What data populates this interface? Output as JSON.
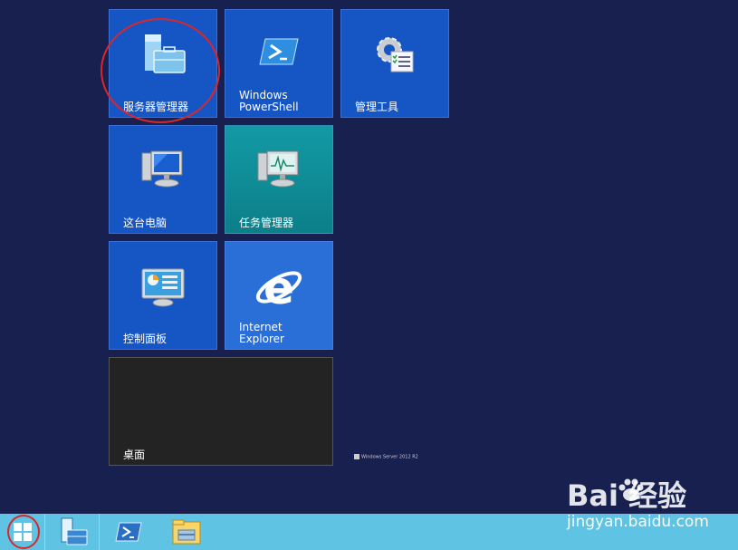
{
  "tiles": {
    "server_manager": {
      "label": "服务器管理器",
      "icon": "server-manager-icon"
    },
    "powershell": {
      "label": "Windows\nPowerShell",
      "icon": "powershell-icon"
    },
    "admin_tools": {
      "label": "管理工具",
      "icon": "admin-tools-icon"
    },
    "this_pc": {
      "label": "这台电脑",
      "icon": "computer-icon"
    },
    "task_manager": {
      "label": "任务管理器",
      "icon": "task-manager-icon"
    },
    "control_panel": {
      "label": "控制面板",
      "icon": "control-panel-icon"
    },
    "ie": {
      "label": "Internet\nExplorer",
      "icon": "internet-explorer-icon"
    },
    "desktop": {
      "label": "桌面",
      "watermark": "Windows Server 2012 R2"
    }
  },
  "taskbar": {
    "items": [
      "start-button",
      "server-manager",
      "powershell",
      "file-explorer"
    ]
  },
  "overlay": {
    "brand": "Bai  经验",
    "url": "jingyan.baidu.com"
  },
  "colors": {
    "background": "#17204e",
    "tile_blue": "#1656c4",
    "tile_teal": "#129aa4",
    "taskbar": "#5fc3e4",
    "highlight_circle": "#d9262c"
  }
}
